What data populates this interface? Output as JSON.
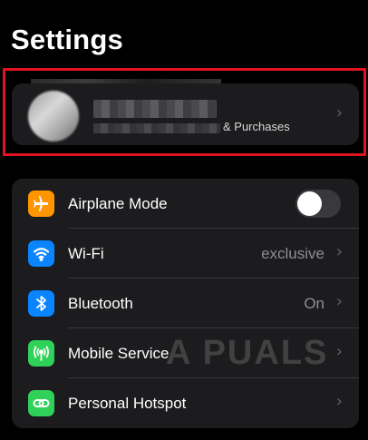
{
  "page": {
    "title": "Settings"
  },
  "account": {
    "subtitle_suffix": "& Purchases"
  },
  "rows": [
    {
      "label": "Airplane Mode",
      "icon": "airplane-icon",
      "icon_color": "#ff9500",
      "control": "toggle",
      "toggle_on": false
    },
    {
      "label": "Wi-Fi",
      "value": "exclusive",
      "icon": "wifi-icon",
      "icon_color": "#0a84ff"
    },
    {
      "label": "Bluetooth",
      "value": "On",
      "icon": "bluetooth-icon",
      "icon_color": "#0a84ff"
    },
    {
      "label": "Mobile Service",
      "value": "",
      "icon": "antenna-icon",
      "icon_color": "#30d158"
    },
    {
      "label": "Personal Hotspot",
      "value": "",
      "icon": "hotspot-icon",
      "icon_color": "#30d158"
    }
  ],
  "watermark": {
    "text": "A  PUALS"
  },
  "colors": {
    "background": "#000000",
    "card": "#1c1c1e",
    "highlight_border": "#e0141d",
    "secondary_text": "#8e8e93"
  }
}
